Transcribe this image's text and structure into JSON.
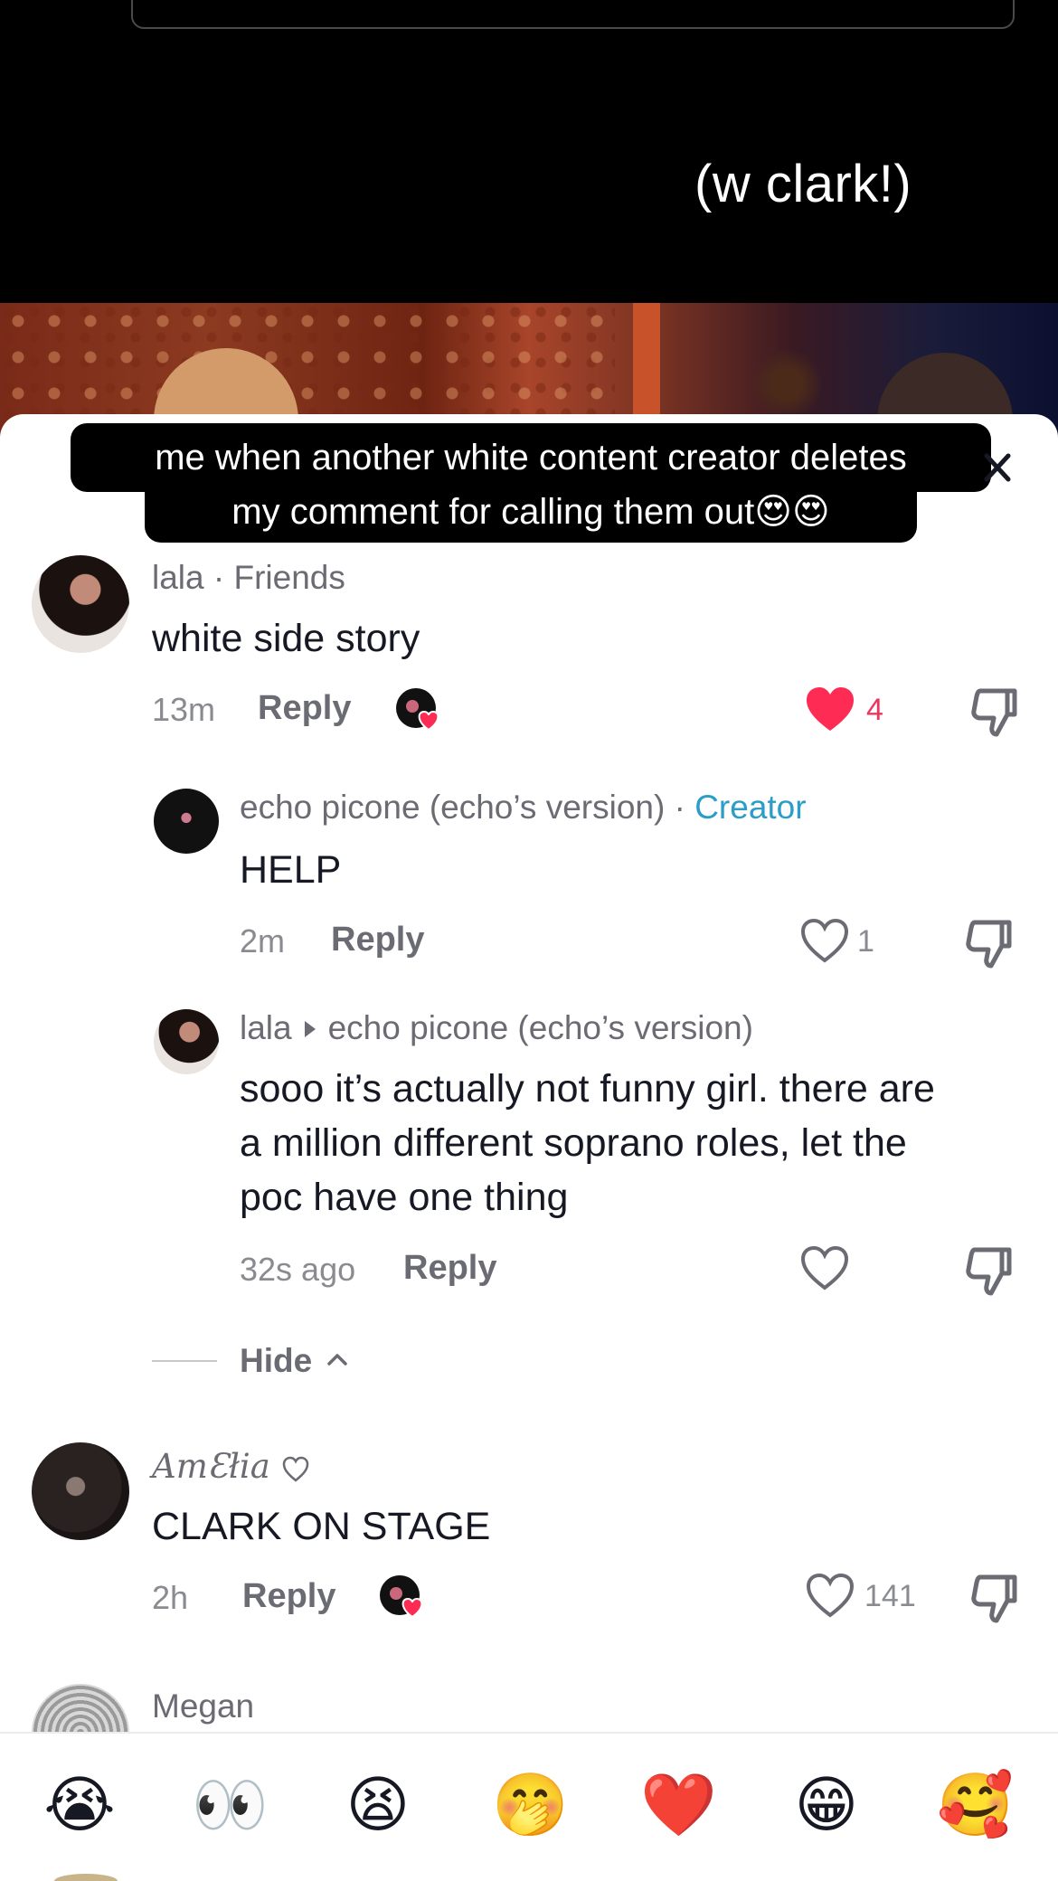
{
  "video": {
    "caption": "(w clark!)"
  },
  "banner": {
    "line1": "me when another white content creator deletes",
    "line2": "my comment for calling them out😍😍"
  },
  "comments": [
    {
      "user": "lala",
      "tag": " · Friends",
      "text": "white side story",
      "time": "13m",
      "reply": "Reply",
      "likes": "4",
      "liked": true,
      "creator_liked": true,
      "replies": [
        {
          "user": "echo picone (echo’s version)",
          "tag": " · ",
          "creator": "Creator",
          "text": "HELP",
          "time": "2m",
          "reply": "Reply",
          "likes": "1"
        },
        {
          "user": "lala",
          "reply_to": "echo picone (echo’s version)",
          "text_lines": [
            "sooo it’s actually not funny girl. there are",
            "a million different soprano roles, let the",
            "poc have one thing"
          ],
          "time": "32s ago",
          "reply": "Reply",
          "likes": ""
        }
      ],
      "hide": "Hide"
    },
    {
      "user": "AmƐłia",
      "text": "CLARK ON STAGE",
      "time": "2h",
      "reply": "Reply",
      "likes": "141",
      "creator_liked": true
    },
    {
      "user": "Megan"
    }
  ],
  "emoji_bar": [
    "😭",
    "👀",
    "😫",
    "🤭",
    "❤️",
    "😁",
    "🥰"
  ],
  "icons": {
    "like": "heart-icon",
    "dislike": "thumbs-down-icon",
    "close": "close-icon",
    "search": "search-icon"
  },
  "colors": {
    "liked": "#e8365d",
    "creator": "#2b9dc7"
  }
}
